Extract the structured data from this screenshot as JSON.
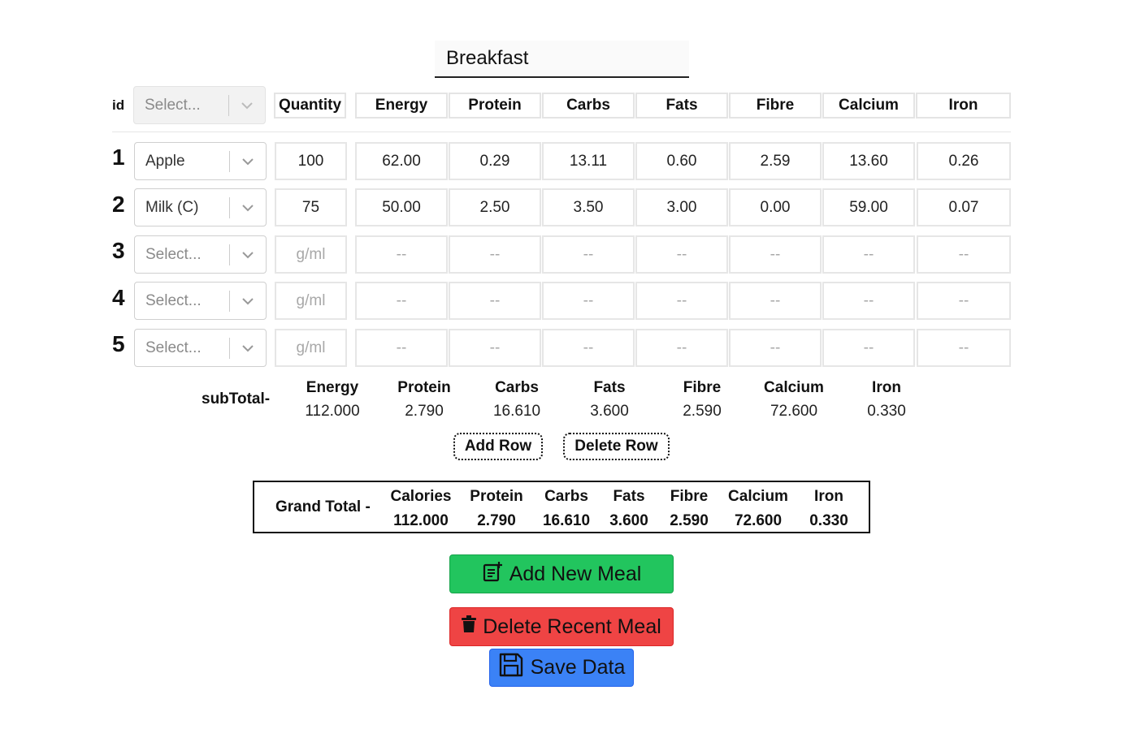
{
  "meal": {
    "name": "Breakfast"
  },
  "header": {
    "id_label": "id",
    "select_placeholder": "Select...",
    "quantity_label": "Quantity",
    "nutrients": [
      "Energy",
      "Protein",
      "Carbs",
      "Fats",
      "Fibre",
      "Calcium",
      "Iron"
    ]
  },
  "rows": [
    {
      "num": "1",
      "food": "Apple",
      "quantity": "100",
      "values": [
        "62.00",
        "0.29",
        "13.11",
        "0.60",
        "2.59",
        "13.60",
        "0.26"
      ]
    },
    {
      "num": "2",
      "food": "Milk (C)",
      "quantity": "75",
      "values": [
        "50.00",
        "2.50",
        "3.50",
        "3.00",
        "0.00",
        "59.00",
        "0.07"
      ]
    },
    {
      "num": "3",
      "food": "Select...",
      "quantity": "g/ml",
      "values": [
        "--",
        "--",
        "--",
        "--",
        "--",
        "--",
        "--"
      ]
    },
    {
      "num": "4",
      "food": "Select...",
      "quantity": "g/ml",
      "values": [
        "--",
        "--",
        "--",
        "--",
        "--",
        "--",
        "--"
      ]
    },
    {
      "num": "5",
      "food": "Select...",
      "quantity": "g/ml",
      "values": [
        "--",
        "--",
        "--",
        "--",
        "--",
        "--",
        "--"
      ]
    }
  ],
  "subtotal": {
    "label": "subTotal-",
    "names": [
      "Energy",
      "Protein",
      "Carbs",
      "Fats",
      "Fibre",
      "Calcium",
      "Iron"
    ],
    "values": [
      "112.000",
      "2.790",
      "16.610",
      "3.600",
      "2.590",
      "72.600",
      "0.330"
    ]
  },
  "row_buttons": {
    "add": "Add Row",
    "delete": "Delete Row"
  },
  "grand_total": {
    "label": "Grand Total -",
    "names": [
      "Calories",
      "Protein",
      "Carbs",
      "Fats",
      "Fibre",
      "Calcium",
      "Iron"
    ],
    "values": [
      "112.000",
      "2.790",
      "16.610",
      "3.600",
      "2.590",
      "72.600",
      "0.330"
    ]
  },
  "actions": {
    "add_meal": "Add New Meal",
    "delete_meal": "Delete Recent Meal",
    "save": "Save Data"
  },
  "colors": {
    "add_meal": "#22c55e",
    "delete_meal": "#ef4444",
    "save": "#3b82f6"
  },
  "icons": {
    "add_meal": "note-add-icon",
    "delete_meal": "trash-icon",
    "save": "floppy-disk-icon",
    "select_arrow": "chevron-down-icon"
  }
}
